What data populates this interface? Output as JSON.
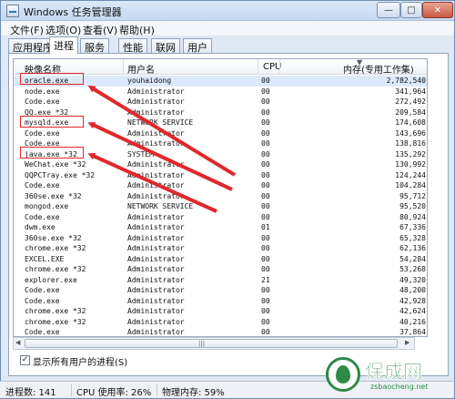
{
  "window": {
    "title": "Windows 任务管理器"
  },
  "title_buttons": {
    "minimize": "—",
    "maximize": "□",
    "close": "✕"
  },
  "menu": [
    "文件(F)",
    "选项(O)",
    "查看(V)",
    "帮助(H)"
  ],
  "tabs": [
    "应用程序",
    "进程",
    "服务",
    "性能",
    "联网",
    "用户"
  ],
  "active_tab": "进程",
  "columns": {
    "name": "映像名称",
    "user": "用户名",
    "cpu": "CPU",
    "mem": "内存(专用工作集)"
  },
  "rows": [
    {
      "name": "oracle.exe",
      "user": "youhaidong",
      "cpu": "00",
      "mem": "2,782,540"
    },
    {
      "name": "node.exe",
      "user": "Administrator",
      "cpu": "00",
      "mem": "341,964"
    },
    {
      "name": "Code.exe",
      "user": "Administrator",
      "cpu": "00",
      "mem": "272,492"
    },
    {
      "name": "QQ.exe *32",
      "user": "Administrator",
      "cpu": "00",
      "mem": "209,584"
    },
    {
      "name": "mysqld.exe",
      "user": "NETWORK SERVICE",
      "cpu": "00",
      "mem": "174,608"
    },
    {
      "name": "Code.exe",
      "user": "Administrator",
      "cpu": "00",
      "mem": "143,696"
    },
    {
      "name": "Code.exe",
      "user": "Administrator",
      "cpu": "00",
      "mem": "138,816"
    },
    {
      "name": "java.exe *32",
      "user": "SYSTEM",
      "cpu": "00",
      "mem": "135,292"
    },
    {
      "name": "WeChat.exe *32",
      "user": "Administrator",
      "cpu": "00",
      "mem": "130,992"
    },
    {
      "name": "QQPCTray.exe *32",
      "user": "Administrator",
      "cpu": "00",
      "mem": "124,244"
    },
    {
      "name": "Code.exe",
      "user": "Administrator",
      "cpu": "00",
      "mem": "104,284"
    },
    {
      "name": "360se.exe *32",
      "user": "Administrator",
      "cpu": "00",
      "mem": "95,712"
    },
    {
      "name": "mongod.exe",
      "user": "NETWORK SERVICE",
      "cpu": "00",
      "mem": "95,520"
    },
    {
      "name": "Code.exe",
      "user": "Administrator",
      "cpu": "00",
      "mem": "80,924"
    },
    {
      "name": "dwm.exe",
      "user": "Administrator",
      "cpu": "01",
      "mem": "67,336"
    },
    {
      "name": "360se.exe *32",
      "user": "Administrator",
      "cpu": "00",
      "mem": "65,328"
    },
    {
      "name": "chrome.exe *32",
      "user": "Administrator",
      "cpu": "00",
      "mem": "62,136"
    },
    {
      "name": "EXCEL.EXE",
      "user": "Administrator",
      "cpu": "00",
      "mem": "54,284"
    },
    {
      "name": "chrome.exe *32",
      "user": "Administrator",
      "cpu": "00",
      "mem": "53,268"
    },
    {
      "name": "explorer.exe",
      "user": "Administrator",
      "cpu": "21",
      "mem": "49,320"
    },
    {
      "name": "Code.exe",
      "user": "Administrator",
      "cpu": "00",
      "mem": "48,200"
    },
    {
      "name": "Code.exe",
      "user": "Administrator",
      "cpu": "00",
      "mem": "42,928"
    },
    {
      "name": "chrome.exe *32",
      "user": "Administrator",
      "cpu": "00",
      "mem": "42,624"
    },
    {
      "name": "chrome.exe *32",
      "user": "Administrator",
      "cpu": "00",
      "mem": "40,216"
    },
    {
      "name": "Code.exe",
      "user": "Administrator",
      "cpu": "00",
      "mem": "37,864"
    }
  ],
  "show_all_processes": {
    "label": "显示所有用户的进程(S)",
    "checked": true
  },
  "statusbar": {
    "processes": "进程数: 141",
    "cpu": "CPU 使用率: 26%",
    "memory": "物理内存: 59%"
  },
  "annotation_color": "#e0282c",
  "watermark": {
    "title": "保成网",
    "url": "zsbaocheng.net"
  }
}
